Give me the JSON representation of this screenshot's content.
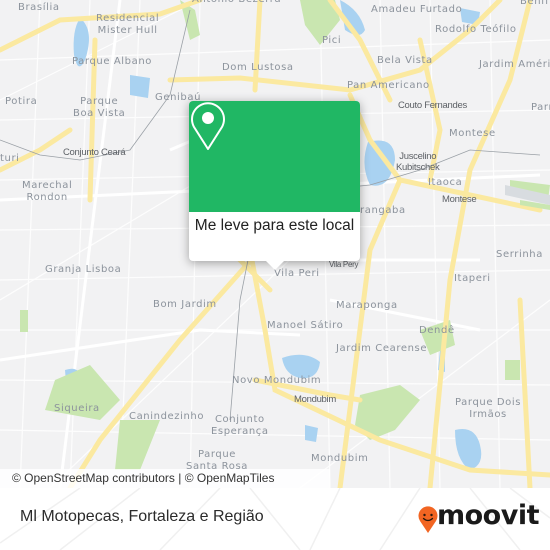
{
  "map": {
    "labels": [
      {
        "id": "brasilia",
        "text": "Brasília"
      },
      {
        "id": "residencial",
        "text": "Residencial\nMister Hull"
      },
      {
        "id": "antonio",
        "text": "Antônio Bezerra"
      },
      {
        "id": "amadeu",
        "text": "Amadeu Furtado"
      },
      {
        "id": "benfica",
        "text": "Benfi"
      },
      {
        "id": "parque-albano",
        "text": "Parque Albano"
      },
      {
        "id": "pici",
        "text": "Pici"
      },
      {
        "id": "bela-vista",
        "text": "Bela Vista"
      },
      {
        "id": "rodolfo",
        "text": "Rodolfo Teófilo"
      },
      {
        "id": "dom-lustosa",
        "text": "Dom Lustosa"
      },
      {
        "id": "jardim-america",
        "text": "Jardim Améri"
      },
      {
        "id": "pan-americano",
        "text": "Pan Americano"
      },
      {
        "id": "potira",
        "text": "Potira"
      },
      {
        "id": "parque-boa-vista",
        "text": "Parque\nBoa Vista"
      },
      {
        "id": "genibau",
        "text": "Genibaú"
      },
      {
        "id": "couto",
        "text": "Couto Fernandes"
      },
      {
        "id": "parr",
        "text": "Parr"
      },
      {
        "id": "montese",
        "text": "Montese"
      },
      {
        "id": "conjunto-ceara",
        "text": "Conjunto Ceará"
      },
      {
        "id": "turi",
        "text": "turi"
      },
      {
        "id": "juscelino",
        "text": "Juscelino\nKubitschek"
      },
      {
        "id": "itaoca",
        "text": "Itaoca"
      },
      {
        "id": "montese2",
        "text": "Montese"
      },
      {
        "id": "marechal",
        "text": "Marechal\nRondon"
      },
      {
        "id": "parangaba",
        "text": "rangaba"
      },
      {
        "id": "vila-peri-small",
        "text": "Vila Pery"
      },
      {
        "id": "vila-peri",
        "text": "Vila Peri"
      },
      {
        "id": "granja",
        "text": "Granja Lisboa"
      },
      {
        "id": "serrinha",
        "text": "Serrinha"
      },
      {
        "id": "itaperi",
        "text": "Itaperi"
      },
      {
        "id": "bom-jardim",
        "text": "Bom Jardim"
      },
      {
        "id": "maraponga",
        "text": "Maraponga"
      },
      {
        "id": "manoel",
        "text": "Manoel Sátiro"
      },
      {
        "id": "dende",
        "text": "Dendê"
      },
      {
        "id": "jardim-cearense",
        "text": "Jardim Cearense"
      },
      {
        "id": "novo-mondubim",
        "text": "Novo Mondubim"
      },
      {
        "id": "mondubim-small",
        "text": "Mondubim"
      },
      {
        "id": "siqueira",
        "text": "Siqueira"
      },
      {
        "id": "canindezinho",
        "text": "Canindezinho"
      },
      {
        "id": "conjunto-esperanca",
        "text": "Conjunto\nEsperança"
      },
      {
        "id": "parque-dois",
        "text": "Parque Dois\nIrmãos"
      },
      {
        "id": "parque-santa-rosa",
        "text": "Parque\nSanta Rosa"
      },
      {
        "id": "mondubim",
        "text": "Mondubim"
      }
    ],
    "attribution": "© OpenStreetMap contributors | © OpenMapTiles"
  },
  "popup": {
    "icon": "location-pin-icon",
    "action_label": "Me leve para este local"
  },
  "footer": {
    "title": "Ml Motopecas, Fortaleza e Região",
    "logo_text": "moovit",
    "logo_color": "#f26522"
  },
  "colors": {
    "popup_green": "#20b764",
    "road_yellow": "#fbe9a0",
    "water": "#a9d2f1",
    "park": "#c9e6b0"
  }
}
